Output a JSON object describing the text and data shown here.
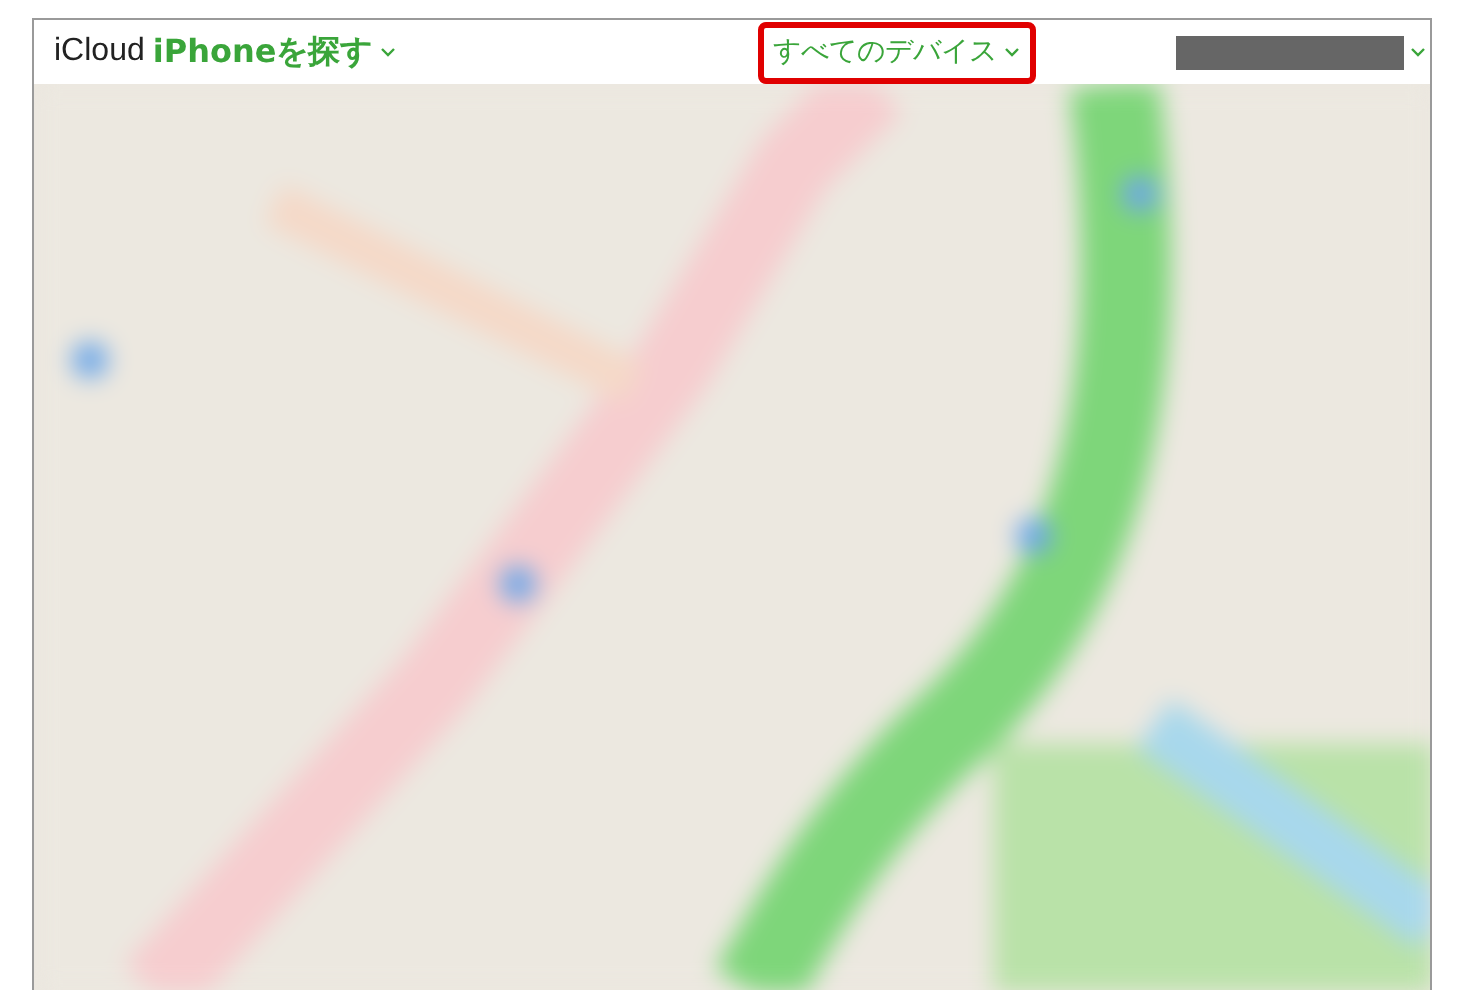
{
  "header": {
    "brand": "iCloud",
    "app_menu": "iPhoneを探す",
    "device_menu": {
      "label": "すべてのデバイス",
      "highlighted": true
    }
  }
}
